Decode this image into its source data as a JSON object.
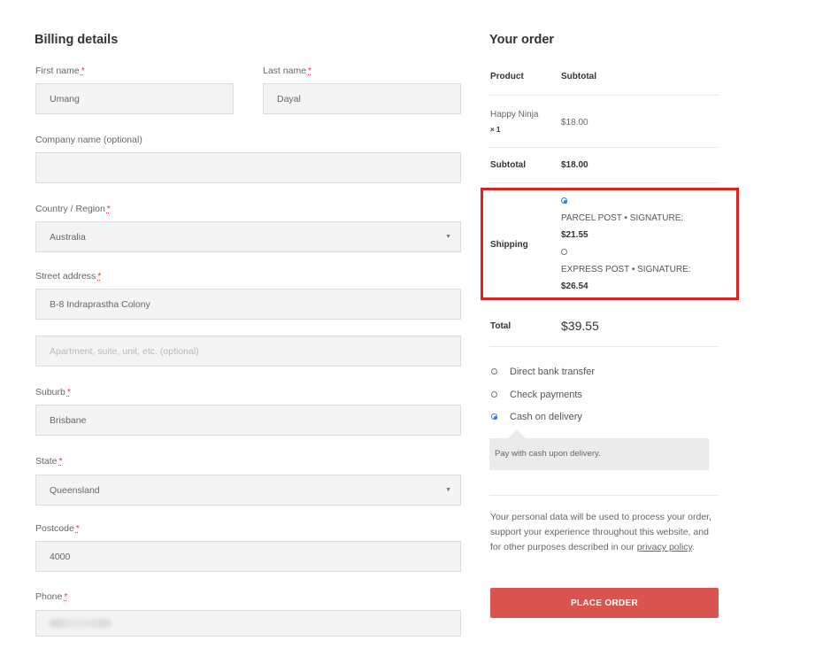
{
  "billing": {
    "title": "Billing details",
    "required_mark": "*",
    "first_name": {
      "label": "First name",
      "value": "Umang"
    },
    "last_name": {
      "label": "Last name",
      "value": "Dayal"
    },
    "company": {
      "label": "Company name (optional)",
      "value": ""
    },
    "country": {
      "label": "Country / Region",
      "value": "Australia"
    },
    "street": {
      "label": "Street address",
      "value": "B-8 Indraprastha Colony",
      "line2_placeholder": "Apartment, suite, unit, etc. (optional)"
    },
    "suburb": {
      "label": "Suburb",
      "value": "Brisbane"
    },
    "state": {
      "label": "State",
      "value": "Queensland"
    },
    "postcode": {
      "label": "Postcode",
      "value": "4000"
    },
    "phone": {
      "label": "Phone",
      "value": ""
    }
  },
  "order": {
    "title": "Your order",
    "col_product": "Product",
    "col_subtotal": "Subtotal",
    "item_name": "Happy Ninja",
    "item_qty": "× 1",
    "item_price": "$18.00",
    "subtotal_label": "Subtotal",
    "subtotal_value": "$18.00",
    "shipping_label": "Shipping",
    "shipping_options": [
      {
        "label": "PARCEL POST • SIGNATURE:",
        "price": "$21.55",
        "selected": true
      },
      {
        "label": "EXPRESS POST • SIGNATURE:",
        "price": "$26.54",
        "selected": false
      }
    ],
    "total_label": "Total",
    "total_value": "$39.55"
  },
  "payment": {
    "methods": [
      {
        "label": "Direct bank transfer",
        "selected": false
      },
      {
        "label": "Check payments",
        "selected": false
      },
      {
        "label": "Cash on delivery",
        "selected": true
      }
    ],
    "description": "Pay with cash upon delivery.",
    "privacy_text": "Your personal data will be used to process your order, support your experience throughout this website, and for other purposes described in our",
    "privacy_link": "privacy policy",
    "privacy_end": ".",
    "place_order": "PLACE ORDER"
  },
  "colors": {
    "accent": "#d9534f",
    "highlight": "#e02020",
    "radio": "#2f7fd8"
  }
}
